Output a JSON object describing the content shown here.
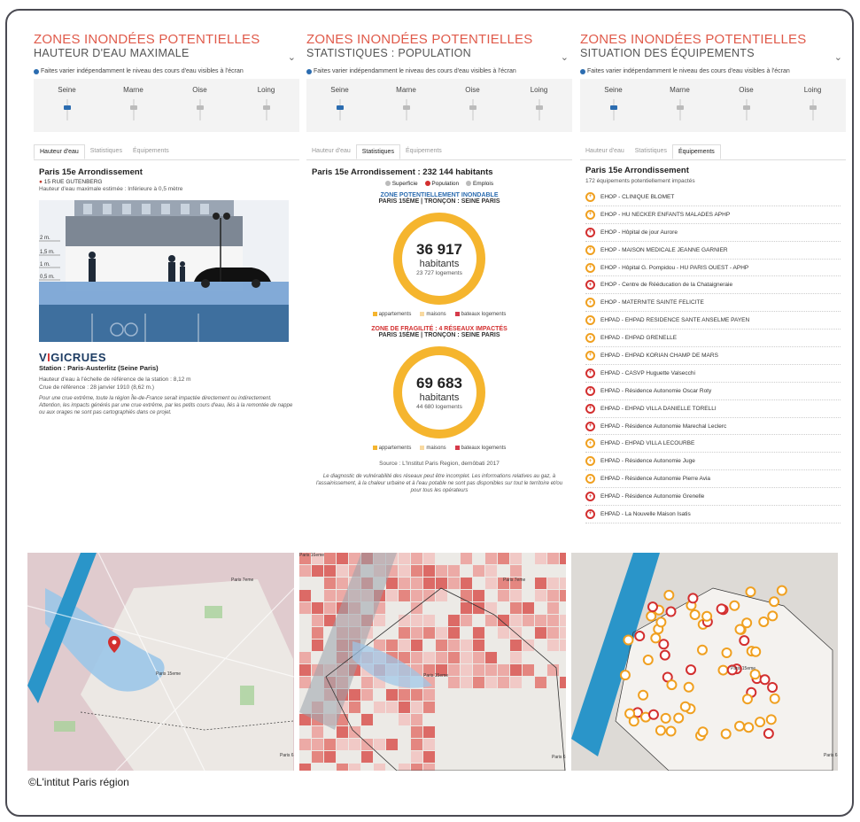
{
  "panels": [
    {
      "title": "ZONES INONDÉES POTENTIELLES",
      "subtitle": "HAUTEUR D'EAU MAXIMALE",
      "info": "Faites varier indépendamment le niveau des cours d'eau visibles à l'écran",
      "rivers": [
        "Seine",
        "Marne",
        "Oise",
        "Loing"
      ],
      "tabs": [
        "Hauteur d'eau",
        "Statistiques",
        "Équipements"
      ],
      "active_tab": 0
    },
    {
      "title": "ZONES INONDÉES POTENTIELLES",
      "subtitle": "STATISTIQUES : POPULATION",
      "info": "Faites varier indépendamment le niveau des cours d'eau visibles à l'écran",
      "rivers": [
        "Seine",
        "Marne",
        "Oise",
        "Loing"
      ],
      "tabs": [
        "Hauteur d'eau",
        "Statistiques",
        "Équipements"
      ],
      "active_tab": 1
    },
    {
      "title": "ZONES INONDÉES POTENTIELLES",
      "subtitle": "SITUATION DES ÉQUIPEMENTS",
      "info": "Faites varier indépendamment le niveau des cours d'eau visibles à l'écran",
      "rivers": [
        "Seine",
        "Marne",
        "Oise",
        "Loing"
      ],
      "tabs": [
        "Hauteur d'eau",
        "Statistiques",
        "Équipements"
      ],
      "active_tab": 2
    }
  ],
  "hauteur": {
    "district": "Paris 15e Arrondissement",
    "address": "15 RUE GUTENBERG",
    "estimate": "Hauteur d'eau maximale estimée : Inférieure à 0,5 mètre",
    "scale": [
      "2 m.",
      "1,5 m.",
      "1 m.",
      "0,5 m."
    ],
    "vigicrues_a": "V",
    "vigicrues_b": "I",
    "vigicrues_c": "GICRUES",
    "station": "Station : Paris-Austerlitz (Seine Paris)",
    "ref_height": "Hauteur d'eau à l'échelle de référence de la station : 8,12 m",
    "ref_flood": "Crue de référence : 28 janvier 1910 (8,62 m.)",
    "note": "Pour une crue extrême, toute la région Île-de-France serait impactée directement ou indirectement. Attention, les impacts générés par une crue extrême, par les petits cours d'eau, liés à la remontée de nappe ou aux orages ne sont pas cartographiés dans ce projet."
  },
  "stats": {
    "heading": "Paris 15e Arrondissement : 232 144 habitants",
    "toggles": [
      "Superficie",
      "Population",
      "Emplois"
    ],
    "zone1_title": "ZONE POTENTIELLEMENT INONDABLE",
    "zone1_sub": "PARIS 15ÈME | TRONÇON : SEINE PARIS",
    "zone1_value": "36 917",
    "zone1_unit": "habitants",
    "zone1_logements": "23 727 logements",
    "zone2_title": "ZONE DE FRAGILITÉ : 4 RÉSEAUX IMPACTÉS",
    "zone2_sub": "PARIS 15ÈME | TRONÇON : SEINE PARIS",
    "zone2_value": "69 683",
    "zone2_unit": "habitants",
    "zone2_logements": "44 680 logements",
    "legend": [
      "appartements",
      "maisons",
      "bateaux logements"
    ],
    "legend_colors": [
      "#f5b52e",
      "#f8d9a0",
      "#d63a4a"
    ],
    "source": "Source : L'Institut Paris Region, demôbati 2017",
    "disclaimer": "Le diagnostic de vulnérabilité des réseaux peut être incomplet. Les informations relatives au gaz, à l'assainissement, à la chaleur urbaine et à l'eau potable ne sont pas disponibles sur tout le territoire et/ou pour tous les opérateurs"
  },
  "equip": {
    "district": "Paris 15e Arrondissement",
    "count": "172 équipements potentiellement impactés",
    "items": [
      {
        "label": "EHOP - CLINIQUE BLOMET",
        "kind": "orange"
      },
      {
        "label": "EHOP - HU NECKER ENFANTS MALADES APHP",
        "kind": "orange"
      },
      {
        "label": "EHOP - Hôpital de jour Aurore",
        "kind": "red"
      },
      {
        "label": "EHOP - MAISON MEDICALE JEANNE GARNIER",
        "kind": "orange"
      },
      {
        "label": "EHOP - Hôpital G. Pompidou - HU PARIS OUEST - APHP",
        "kind": "orange"
      },
      {
        "label": "EHOP - Centre de Rééducation de la Chataigneraie",
        "kind": "red"
      },
      {
        "label": "EHOP - MATERNITE SAINTE FELICITE",
        "kind": "orange"
      },
      {
        "label": "EHPAD - EHPAD RESIDENCE SANTE ANSELME PAYEN",
        "kind": "orange"
      },
      {
        "label": "EHPAD - EHPAD GRENELLE",
        "kind": "orange"
      },
      {
        "label": "EHPAD - EHPAD KORIAN CHAMP DE MARS",
        "kind": "orange"
      },
      {
        "label": "EHPAD - CASVP Huguette Valsecchi",
        "kind": "red"
      },
      {
        "label": "EHPAD - Résidence Autonomie Oscar Roty",
        "kind": "red"
      },
      {
        "label": "EHPAD - EHPAD VILLA DANIELLE TORELLI",
        "kind": "red"
      },
      {
        "label": "EHPAD - Résidence Autonomie Marechal Leclerc",
        "kind": "red"
      },
      {
        "label": "EHPAD - EHPAD VILLA LECOURBE",
        "kind": "orange"
      },
      {
        "label": "EHPAD - Résidence Autonomie Juge",
        "kind": "orange"
      },
      {
        "label": "EHPAD - Résidence Autonomie Pierre Avia",
        "kind": "orange"
      },
      {
        "label": "EHPAD - Résidence Autonomie Grenelle",
        "kind": "red"
      },
      {
        "label": "EHPAD - La Nouvelle Maison Isatis",
        "kind": "red"
      }
    ]
  },
  "maps": {
    "label_center": "Paris 15eme",
    "label_ne": "Paris 7eme",
    "label_se": "Paris 6",
    "label_nw": "Paris 16eme"
  },
  "credit": "©L'intitut Paris région",
  "colors": {
    "accent": "#e05a4a",
    "navy": "#1d3c63",
    "donut": "#f5b52e"
  }
}
